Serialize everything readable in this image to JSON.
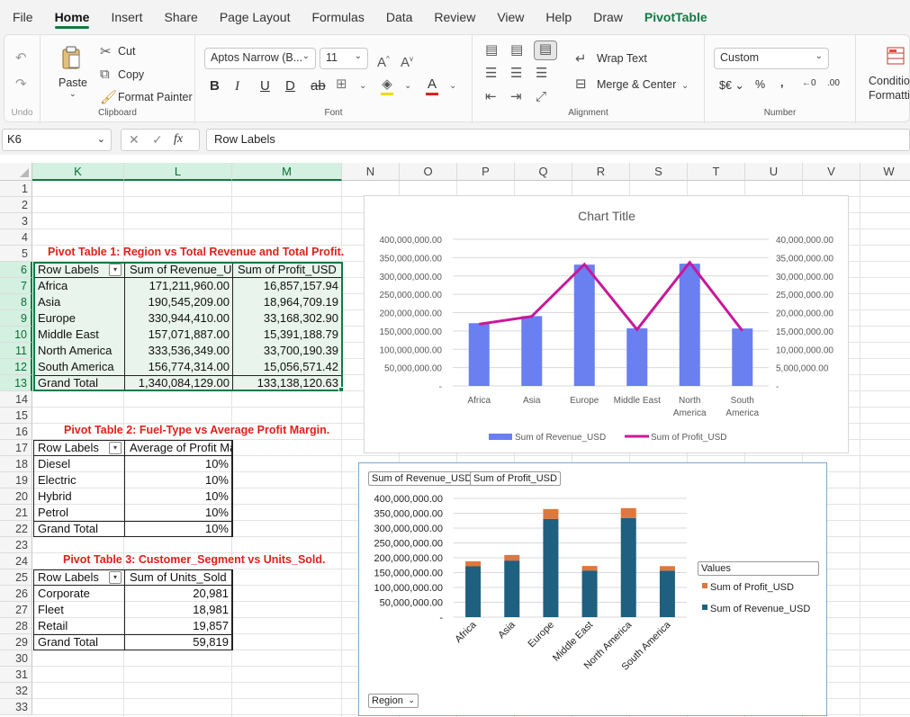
{
  "menu": {
    "tabs": [
      "File",
      "Home",
      "Insert",
      "Share",
      "Page Layout",
      "Formulas",
      "Data",
      "Review",
      "View",
      "Help",
      "Draw",
      "PivotTable"
    ],
    "active": "Home"
  },
  "ribbon": {
    "undo_group_label": "Undo",
    "paste_label": "Paste",
    "cut_label": "Cut",
    "copy_label": "Copy",
    "format_painter_label": "Format Painter",
    "clipboard_label": "Clipboard",
    "font_name": "Aptos Narrow (B...",
    "font_size": "11",
    "font_label": "Font",
    "wrap_text_label": "Wrap Text",
    "merge_center_label": "Merge & Center",
    "alignment_label": "Alignment",
    "number_format": "Custom",
    "number_label": "Number",
    "conditional_formatting_label1": "Conditio",
    "conditional_formatting_label2": "Formattin"
  },
  "formula_bar": {
    "name_box": "K6",
    "fx": "fx",
    "formula": "Row Labels"
  },
  "columns": [
    "K",
    "L",
    "M",
    "N",
    "O",
    "P",
    "Q",
    "R",
    "S",
    "T",
    "U",
    "V",
    "W"
  ],
  "rows": [
    "1",
    "2",
    "3",
    "4",
    "5",
    "6",
    "7",
    "8",
    "9",
    "10",
    "11",
    "12",
    "13",
    "14",
    "15",
    "16",
    "17",
    "18",
    "19",
    "20",
    "21",
    "22",
    "23",
    "24",
    "25",
    "26",
    "27",
    "28",
    "29",
    "30",
    "31",
    "32",
    "33"
  ],
  "pivot1": {
    "title": "Pivot Table 1: Region vs Total Revenue and Total Profit.",
    "headers": [
      "Row Labels",
      "Sum of Revenue_US",
      "Sum of Profit_USD"
    ],
    "rows": [
      [
        "Africa",
        "171,211,960.00",
        "16,857,157.94"
      ],
      [
        "Asia",
        "190,545,209.00",
        "18,964,709.19"
      ],
      [
        "Europe",
        "330,944,410.00",
        "33,168,302.90"
      ],
      [
        "Middle East",
        "157,071,887.00",
        "15,391,188.79"
      ],
      [
        "North America",
        "333,536,349.00",
        "33,700,190.39"
      ],
      [
        "South America",
        "156,774,314.00",
        "15,056,571.42"
      ],
      [
        "Grand Total",
        "1,340,084,129.00",
        "133,138,120.63"
      ]
    ]
  },
  "pivot2": {
    "title": "Pivot Table 2: Fuel-Type vs Average Profit Margin.",
    "headers": [
      "Row Labels",
      "Average of Profit Margin (%)"
    ],
    "rows": [
      [
        "Diesel",
        "10%"
      ],
      [
        "Electric",
        "10%"
      ],
      [
        "Hybrid",
        "10%"
      ],
      [
        "Petrol",
        "10%"
      ],
      [
        "Grand Total",
        "10%"
      ]
    ]
  },
  "pivot3": {
    "title": "Pivot Table 3: Customer_Segment vs Units_Sold.",
    "headers": [
      "Row Labels",
      "Sum of Units_Sold"
    ],
    "rows": [
      [
        "Corporate",
        "20,981"
      ],
      [
        "Fleet",
        "18,981"
      ],
      [
        "Retail",
        "19,857"
      ],
      [
        "Grand Total",
        "59,819"
      ]
    ]
  },
  "chart_data": [
    {
      "type": "bar",
      "title": "Chart Title",
      "categories": [
        "Africa",
        "Asia",
        "Europe",
        "Middle East",
        "North America",
        "South America"
      ],
      "series": [
        {
          "name": "Sum of Revenue_USD",
          "kind": "bar",
          "axis": "primary",
          "color": "#6a7ff0",
          "values": [
            171211960,
            190545209,
            330944410,
            157071887,
            333536349,
            156774314
          ]
        },
        {
          "name": "Sum of Profit_USD",
          "kind": "line",
          "axis": "secondary",
          "color": "#c8189a",
          "values": [
            16857157.94,
            18964709.19,
            33168302.9,
            15391188.79,
            33700190.39,
            15056571.42
          ]
        }
      ],
      "ylim": [
        0,
        400000000
      ],
      "y_ticks": [
        "-",
        "50,000,000.00",
        "100,000,000.00",
        "150,000,000.00",
        "200,000,000.00",
        "250,000,000.00",
        "300,000,000.00",
        "350,000,000.00",
        "400,000,000.00"
      ],
      "y2lim": [
        0,
        40000000
      ],
      "y2_ticks": [
        "-",
        "5,000,000.00",
        "10,000,000.00",
        "15,000,000.00",
        "20,000,000.00",
        "25,000,000.00",
        "30,000,000.00",
        "35,000,000.00",
        "40,000,000.00"
      ],
      "grid": true,
      "legend": "bottom"
    },
    {
      "type": "bar",
      "stacked": true,
      "categories": [
        "Africa",
        "Asia",
        "Europe",
        "Middle East",
        "North America",
        "South America"
      ],
      "series": [
        {
          "name": "Sum of Revenue_USD",
          "color": "#1f5f7f",
          "values": [
            171211960,
            190545209,
            330944410,
            157071887,
            333536349,
            156774314
          ]
        },
        {
          "name": "Sum of Profit_USD",
          "color": "#e0773c",
          "values": [
            16857157.94,
            18964709.19,
            33168302.9,
            15391188.79,
            33700190.39,
            15056571.42
          ]
        }
      ],
      "ylim": [
        0,
        400000000
      ],
      "y_ticks": [
        "-",
        "50,000,000.00",
        "100,000,000.00",
        "150,000,000.00",
        "200,000,000.00",
        "250,000,000.00",
        "300,000,000.00",
        "350,000,000.00",
        "400,000,000.00"
      ],
      "grid": true,
      "legend": "right",
      "legend_title": "Values",
      "field_buttons": [
        "Sum of Revenue_USD",
        "Sum of Profit_USD"
      ],
      "axis_field_button": "Region"
    }
  ]
}
